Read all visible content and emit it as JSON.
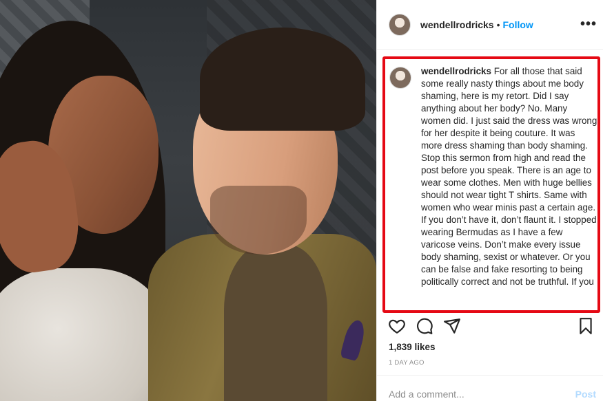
{
  "header": {
    "username": "wendellrodricks",
    "separator": "•",
    "follow_label": "Follow",
    "more_icon": "more-horizontal-icon"
  },
  "comment": {
    "username": "wendellrodricks",
    "text": "For all those that said some really nasty things about me body shaming, here is my retort. Did I say anything about her body? No. Many women did. I just said the dress was wrong for her despite it being couture. It was more dress shaming than body shaming. Stop this sermon from high and read the post before you speak. There is an age to wear some clothes. Men with huge bellies should not wear tight T shirts. Same with women who wear minis past a certain age. If you don’t have it, don’t flaunt it. I stopped wearing Bermudas as I have a few varicose veins. Don’t make every issue body shaming, sexist or whatever. Or you can be false and fake resorting to being politically correct and not be truthful. If you"
  },
  "actions": {
    "like_icon": "heart-icon",
    "comment_icon": "comment-icon",
    "share_icon": "send-icon",
    "save_icon": "bookmark-icon"
  },
  "likes": "1,839 likes",
  "time_ago": "1 DAY AGO",
  "comment_input": {
    "placeholder": "Add a comment...",
    "post_label": "Post"
  },
  "colors": {
    "highlight": "#e50914",
    "follow": "#0095f6",
    "post_disabled": "#b3dbff"
  }
}
